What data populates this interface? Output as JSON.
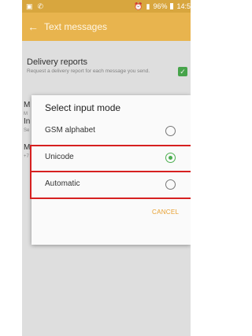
{
  "status_bar": {
    "left_icons": [
      "image-icon",
      "phone-icon"
    ],
    "signal": "⁺ᵢₗ",
    "battery_text": "96%",
    "time": "14:5"
  },
  "app_bar": {
    "back_icon": "back-arrow-icon",
    "title": "Text messages"
  },
  "settings": {
    "delivery_title": "Delivery reports",
    "delivery_desc": "Request a delivery report for each message you send.",
    "delivery_checked": true,
    "peek_1": "M",
    "peek_1_sub": "M",
    "peek_2": "In",
    "peek_2_sub": "Se",
    "peek_3": "M",
    "peek_3_sub": "+7"
  },
  "dialog": {
    "title": "Select input mode",
    "options": [
      {
        "label": "GSM alphabet",
        "selected": false
      },
      {
        "label": "Unicode",
        "selected": true
      },
      {
        "label": "Automatic",
        "selected": false
      }
    ],
    "cancel_label": "CANCEL",
    "accent_color": "#4caf50",
    "highlight_color": "#d62020"
  }
}
